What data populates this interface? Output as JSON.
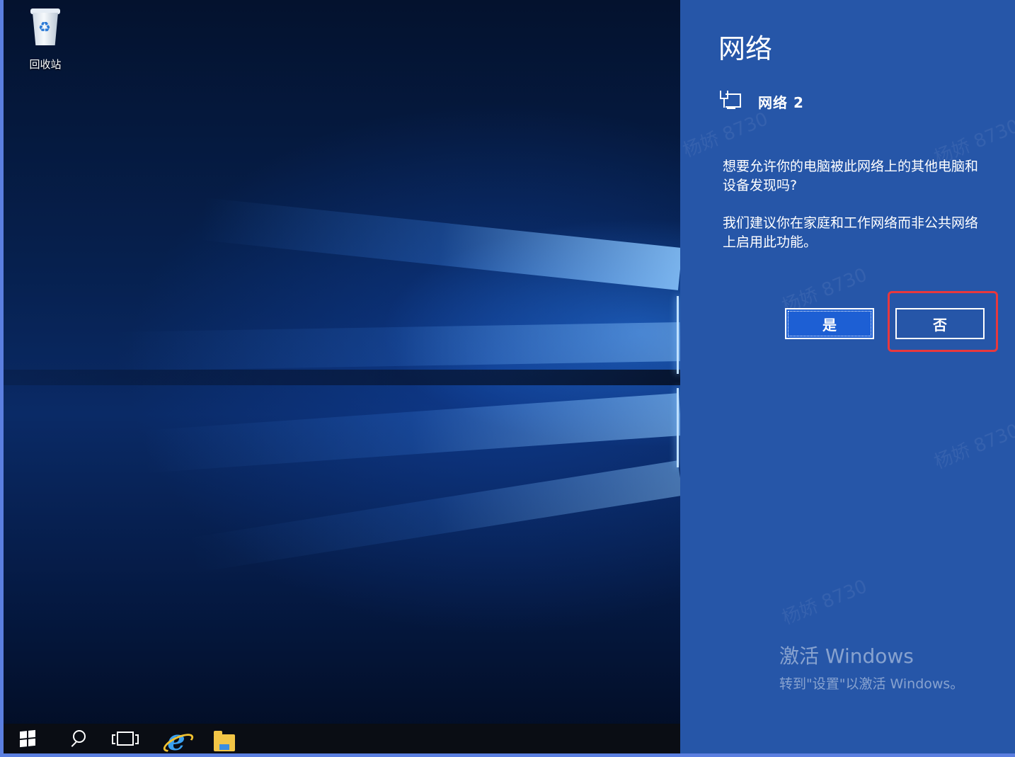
{
  "desktop": {
    "recycle_bin_label": "回收站"
  },
  "taskbar": {
    "items": [
      {
        "name": "start",
        "icon": "windows-logo-icon"
      },
      {
        "name": "search",
        "icon": "search-icon"
      },
      {
        "name": "task-view",
        "icon": "task-view-icon"
      },
      {
        "name": "internet-explorer",
        "icon": "ie-icon"
      },
      {
        "name": "file-explorer",
        "icon": "folder-icon"
      }
    ]
  },
  "network_panel": {
    "title": "网络",
    "network_name": "网络 2",
    "question": "想要允许你的电脑被此网络上的其他电脑和设备发现吗?",
    "recommendation": "我们建议你在家庭和工作网络而非公共网络上启用此功能。",
    "yes_label": "是",
    "no_label": "否",
    "highlight_color": "#e8383d",
    "background_color": "#2656a8"
  },
  "activation": {
    "line1": "激活 Windows",
    "line2": "转到\"设置\"以激活 Windows。"
  }
}
